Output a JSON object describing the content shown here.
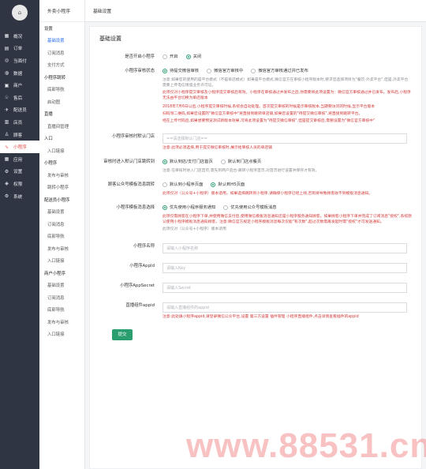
{
  "rail": {
    "logo": "⌂",
    "items": [
      {
        "icon": "grid-icon",
        "glyph": "▦",
        "label": "概况"
      },
      {
        "icon": "order-icon",
        "glyph": "▤",
        "label": "订单"
      },
      {
        "icon": "pay-icon",
        "glyph": "◎",
        "label": "当面付"
      },
      {
        "icon": "data-icon",
        "glyph": "◍",
        "label": "数据"
      },
      {
        "icon": "shop-icon",
        "glyph": "▣",
        "label": "商户"
      },
      {
        "icon": "aftersale-icon",
        "glyph": "♧",
        "label": "售后"
      },
      {
        "icon": "delivery-icon",
        "glyph": "✈",
        "label": "配送员"
      },
      {
        "icon": "store-icon",
        "glyph": "▥",
        "label": "店员"
      },
      {
        "icon": "member-icon",
        "glyph": "♙",
        "label": "顾客"
      },
      {
        "icon": "miniprogram-icon",
        "glyph": "∿",
        "label": "小程序"
      },
      {
        "icon": "apps-icon",
        "glyph": "▦",
        "label": "应用"
      },
      {
        "icon": "settings-icon",
        "glyph": "⚙",
        "label": "设置"
      },
      {
        "icon": "permission-icon",
        "glyph": "◈",
        "label": "权限"
      },
      {
        "icon": "system-icon",
        "glyph": "⚙",
        "label": "系统"
      }
    ],
    "active_index": 9
  },
  "sub": {
    "head": "外卖小程序",
    "items": [
      {
        "label": "设置",
        "group": true
      },
      {
        "label": "基础设置",
        "active": true
      },
      {
        "label": "订阅消息"
      },
      {
        "label": "支付方式"
      },
      {
        "label": "小程序跳转",
        "group": true
      },
      {
        "label": "底部导航"
      },
      {
        "label": "启动图"
      },
      {
        "label": "直播",
        "group": true
      },
      {
        "label": "直播间管理"
      },
      {
        "label": "入口",
        "group": true
      },
      {
        "label": "入口链接"
      },
      {
        "label": "小程序",
        "group": true
      },
      {
        "label": "发布与审核"
      },
      {
        "label": "跳转小程序"
      },
      {
        "label": "配送员小程序",
        "group": true
      },
      {
        "label": "基础设置"
      },
      {
        "label": "订阅消息"
      },
      {
        "label": "底部导航"
      },
      {
        "label": "发布与审核"
      },
      {
        "label": "入口链接"
      },
      {
        "label": "商户小程序",
        "group": true
      },
      {
        "label": "基础设置"
      },
      {
        "label": "订阅消息"
      },
      {
        "label": "底部导航"
      },
      {
        "label": "发布与审核"
      },
      {
        "label": "入口链接"
      }
    ]
  },
  "topbar": {
    "title": "基础设置"
  },
  "panel": {
    "title": "基础设置",
    "enable": {
      "label": "是否开启小程序",
      "options": [
        "开启",
        "关闭"
      ],
      "selected": 1
    },
    "review": {
      "label": "小程序审核状态",
      "options": [
        "待提交微信审核",
        "微信官方审核中",
        "微信官方审核通过并已发布"
      ],
      "selected": 0,
      "note1": "注意:如果您的使用的是平台模式（不是单店模式）如果是平台模式,微信官方在审核小程序版本时,要求您选择项目为\"餐饮-外卖平台\",但是,外卖平台需要上传电信增值业务许可证。",
      "note2": "此项仅对小程序提交审核及小程序提交审核后有效。小程序在审核通过并发布之后,你需要将此项设置为：微信官方审核通过并已发布。发布后,小程序无法由平台切换为单店版本",
      "note3": "2018年7月6日以后,小程序提交审核时候,系统会自动处理。首次提交审核的时候是示审核版本,当期要访问的时候,显示平台版本",
      "note4": "扫码领二维码,如果您设置的\"微信官方审核中\"将直接到跳转单店铺,如果您设置的\"待提交微信审核\",将直接到跳转平台。",
      "note5": "经在上传代码后,如果想要预览测试新版本效果,可将此项设置为\"待提交微信审核\",但是提交审核后,需要设置为\"微信官方审核中\""
    },
    "default_store": {
      "label": "小程序审核时默认门店",
      "placeholder": "==请选择默认门店==",
      "note": "注意:此项必须选择,用于提交微信审核时,展示给审核人员的单店铺"
    },
    "jump": {
      "label": "审核时进入默认门店跳转到",
      "options": [
        "默认到店/支付门店首页",
        "默认到门店点餐页"
      ],
      "selected": 0,
      "note": "注意:在审核时进入门店首页,需先到商户后台-跳转小程序首页,对首页进行设置并保存才有效。"
    },
    "qr": {
      "label": "顾客公众号模板消息跳转",
      "options": [
        "默认到小程序页面",
        "默认到H5页面"
      ],
      "selected": 1,
      "note": "此项仅对（公众号+小程序）版本适用。如果选择跳转到小程序,请确保小程序已经上线,否则将导致顾客收不到模板消息通知。"
    },
    "msg": {
      "label": "小程序模板消息选择",
      "options": [
        "优先使用小程序服务通知",
        "优先使用公众号模板消息"
      ],
      "selected": 0,
      "note1": "此项仅需顾客在小程序下单,并使用微信支付后,使用微信模板消息通知还是小程序服务通知顾客。如果顾客小程序下单并完成了订阅消息\"授权\",系统默认使用小程序模板消息通知顾客。注意:微信官方规定小程序模板消息每次仅能\"有次数\",超过次数需再发起时需\"授权\"才可发送通知。",
      "note2": "此项仅对（公众号+小程序）版本适用"
    },
    "name": {
      "label": "小程序名称",
      "placeholder": "请输入小程序名称"
    },
    "appid": {
      "label": "小程序AppId",
      "placeholder": "请输入Key"
    },
    "secret": {
      "label": "小程序AppSecret",
      "placeholder": "请输入Secret"
    },
    "live": {
      "label": "直播组件appid",
      "placeholder": "请输入直播组件的appid",
      "note": "注意:此处填小程序appid,请登录微信公众平台,设置 第三方设置 插件管理 小程序直播组件,点击详情查看插件的appid"
    },
    "submit": "提交"
  },
  "watermark": "www.88531.cn"
}
